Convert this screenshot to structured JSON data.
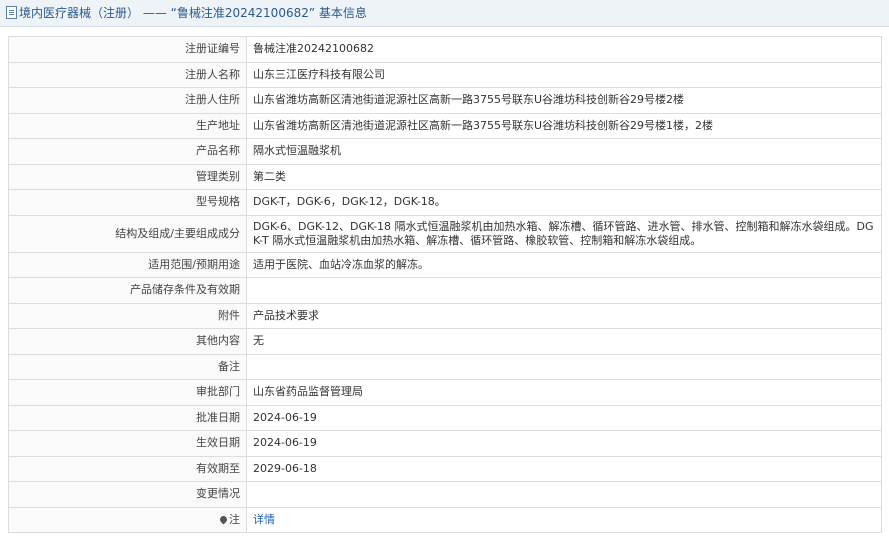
{
  "header": {
    "prefix": "境内医疗器械（注册）",
    "separator": " —— ",
    "reg_title": "“鲁械注准20242100682”",
    "suffix": " 基本信息"
  },
  "rows": [
    {
      "label": "注册证编号",
      "value": "鲁械注准20242100682"
    },
    {
      "label": "注册人名称",
      "value": "山东三江医疗科技有限公司"
    },
    {
      "label": "注册人住所",
      "value": "山东省潍坊高新区清池街道泥源社区高新一路3755号联东U谷潍坊科技创新谷29号楼2楼"
    },
    {
      "label": "生产地址",
      "value": "山东省潍坊高新区清池街道泥源社区高新一路3755号联东U谷潍坊科技创新谷29号楼1楼，2楼"
    },
    {
      "label": "产品名称",
      "value": "隔水式恒温融浆机"
    },
    {
      "label": "管理类别",
      "value": "第二类"
    },
    {
      "label": "型号规格",
      "value": "DGK-T，DGK-6，DGK-12，DGK-18。"
    },
    {
      "label": "结构及组成/主要组成成分",
      "value": "DGK-6、DGK-12、DGK-18 隔水式恒温融浆机由加热水箱、解冻槽、循环管路、进水管、排水管、控制箱和解冻水袋组成。DGK-T 隔水式恒温融浆机由加热水箱、解冻槽、循环管路、橡胶软管、控制箱和解冻水袋组成。"
    },
    {
      "label": "适用范围/预期用途",
      "value": "适用于医院、血站冷冻血浆的解冻。"
    },
    {
      "label": "产品储存条件及有效期",
      "value": ""
    },
    {
      "label": "附件",
      "value": "产品技术要求"
    },
    {
      "label": "其他内容",
      "value": "无"
    },
    {
      "label": "备注",
      "value": ""
    },
    {
      "label": "审批部门",
      "value": "山东省药品监督管理局"
    },
    {
      "label": "批准日期",
      "value": "2024-06-19"
    },
    {
      "label": "生效日期",
      "value": "2024-06-19"
    },
    {
      "label": "有效期至",
      "value": "2029-06-18"
    },
    {
      "label": "变更情况",
      "value": ""
    }
  ],
  "note_row": {
    "label": "注",
    "link": "详情",
    "icon": "pin-icon"
  }
}
